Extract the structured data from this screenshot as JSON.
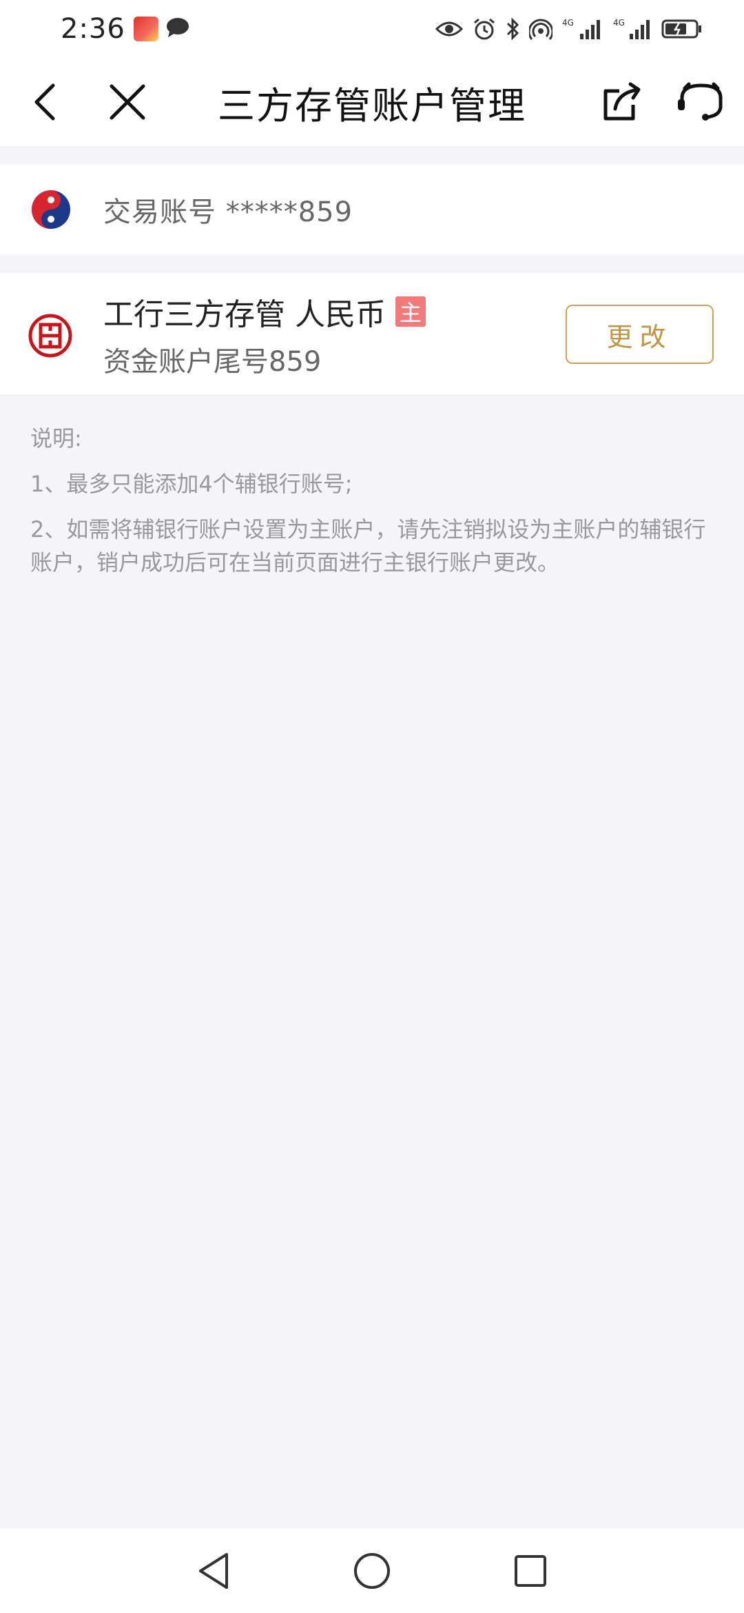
{
  "status_bar": {
    "time": "2:36",
    "icons": [
      "app-notification-icon",
      "chat-icon",
      "eye-icon",
      "alarm-icon",
      "bluetooth-icon",
      "hotspot-icon",
      "signal-4g-icon",
      "signal-4g-icon",
      "battery-charging-icon"
    ]
  },
  "nav": {
    "title": "三方存管账户管理",
    "icons": [
      "back-icon",
      "close-icon",
      "share-icon",
      "customer-service-icon"
    ]
  },
  "trade_account": {
    "label": "交易账号 *****859",
    "icon": "brokerage-logo-icon"
  },
  "bank_account": {
    "title": "工行三方存管 人民币",
    "badge": "主",
    "subtitle": "资金账户尾号859",
    "change_label": "更改",
    "icon": "icbc-logo-icon"
  },
  "notes": {
    "title": "说明:",
    "items": [
      "1、最多只能添加4个辅银行账号;",
      "2、如需将辅银行账户设置为主账户，请先注销拟设为主账户的辅银行账户，销户成功后可在当前页面进行主银行账户更改。"
    ]
  },
  "system_nav": {
    "icons": [
      "nav-back-triangle-icon",
      "nav-home-circle-icon",
      "nav-recent-square-icon"
    ]
  },
  "colors": {
    "accent_gold": "#c09547",
    "badge_red": "#f27a7a",
    "background": "#f4f4f9"
  }
}
